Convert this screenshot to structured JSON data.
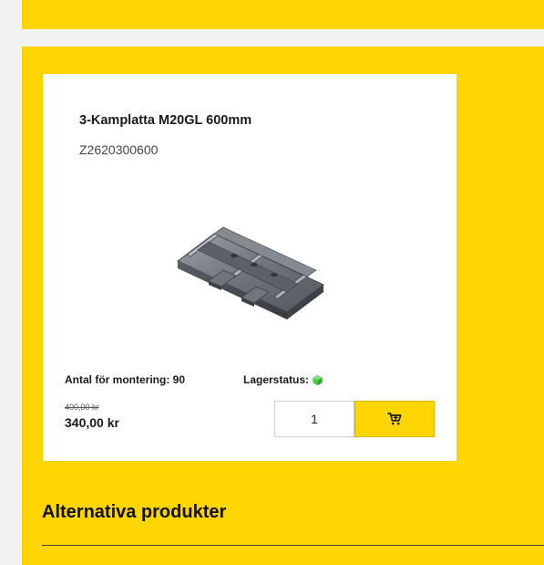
{
  "product": {
    "title": "3-Kamplatta M20GL 600mm",
    "sku": "Z2620300600",
    "image_alt": "track-plate-image",
    "mount_label": "Antal för montering: 90",
    "stock_label": "Lagerstatus:",
    "stock_icon": "green-cube-icon",
    "old_price": "400,00 kr",
    "price": "340,00 kr",
    "quantity_value": "1",
    "cart_icon": "cart-plus-icon"
  },
  "section": {
    "title": "Alternativa produkter"
  },
  "colors": {
    "accent_yellow": "#ffd500",
    "card_bg": "#ffffff",
    "stock_green": "#4cc84c"
  }
}
